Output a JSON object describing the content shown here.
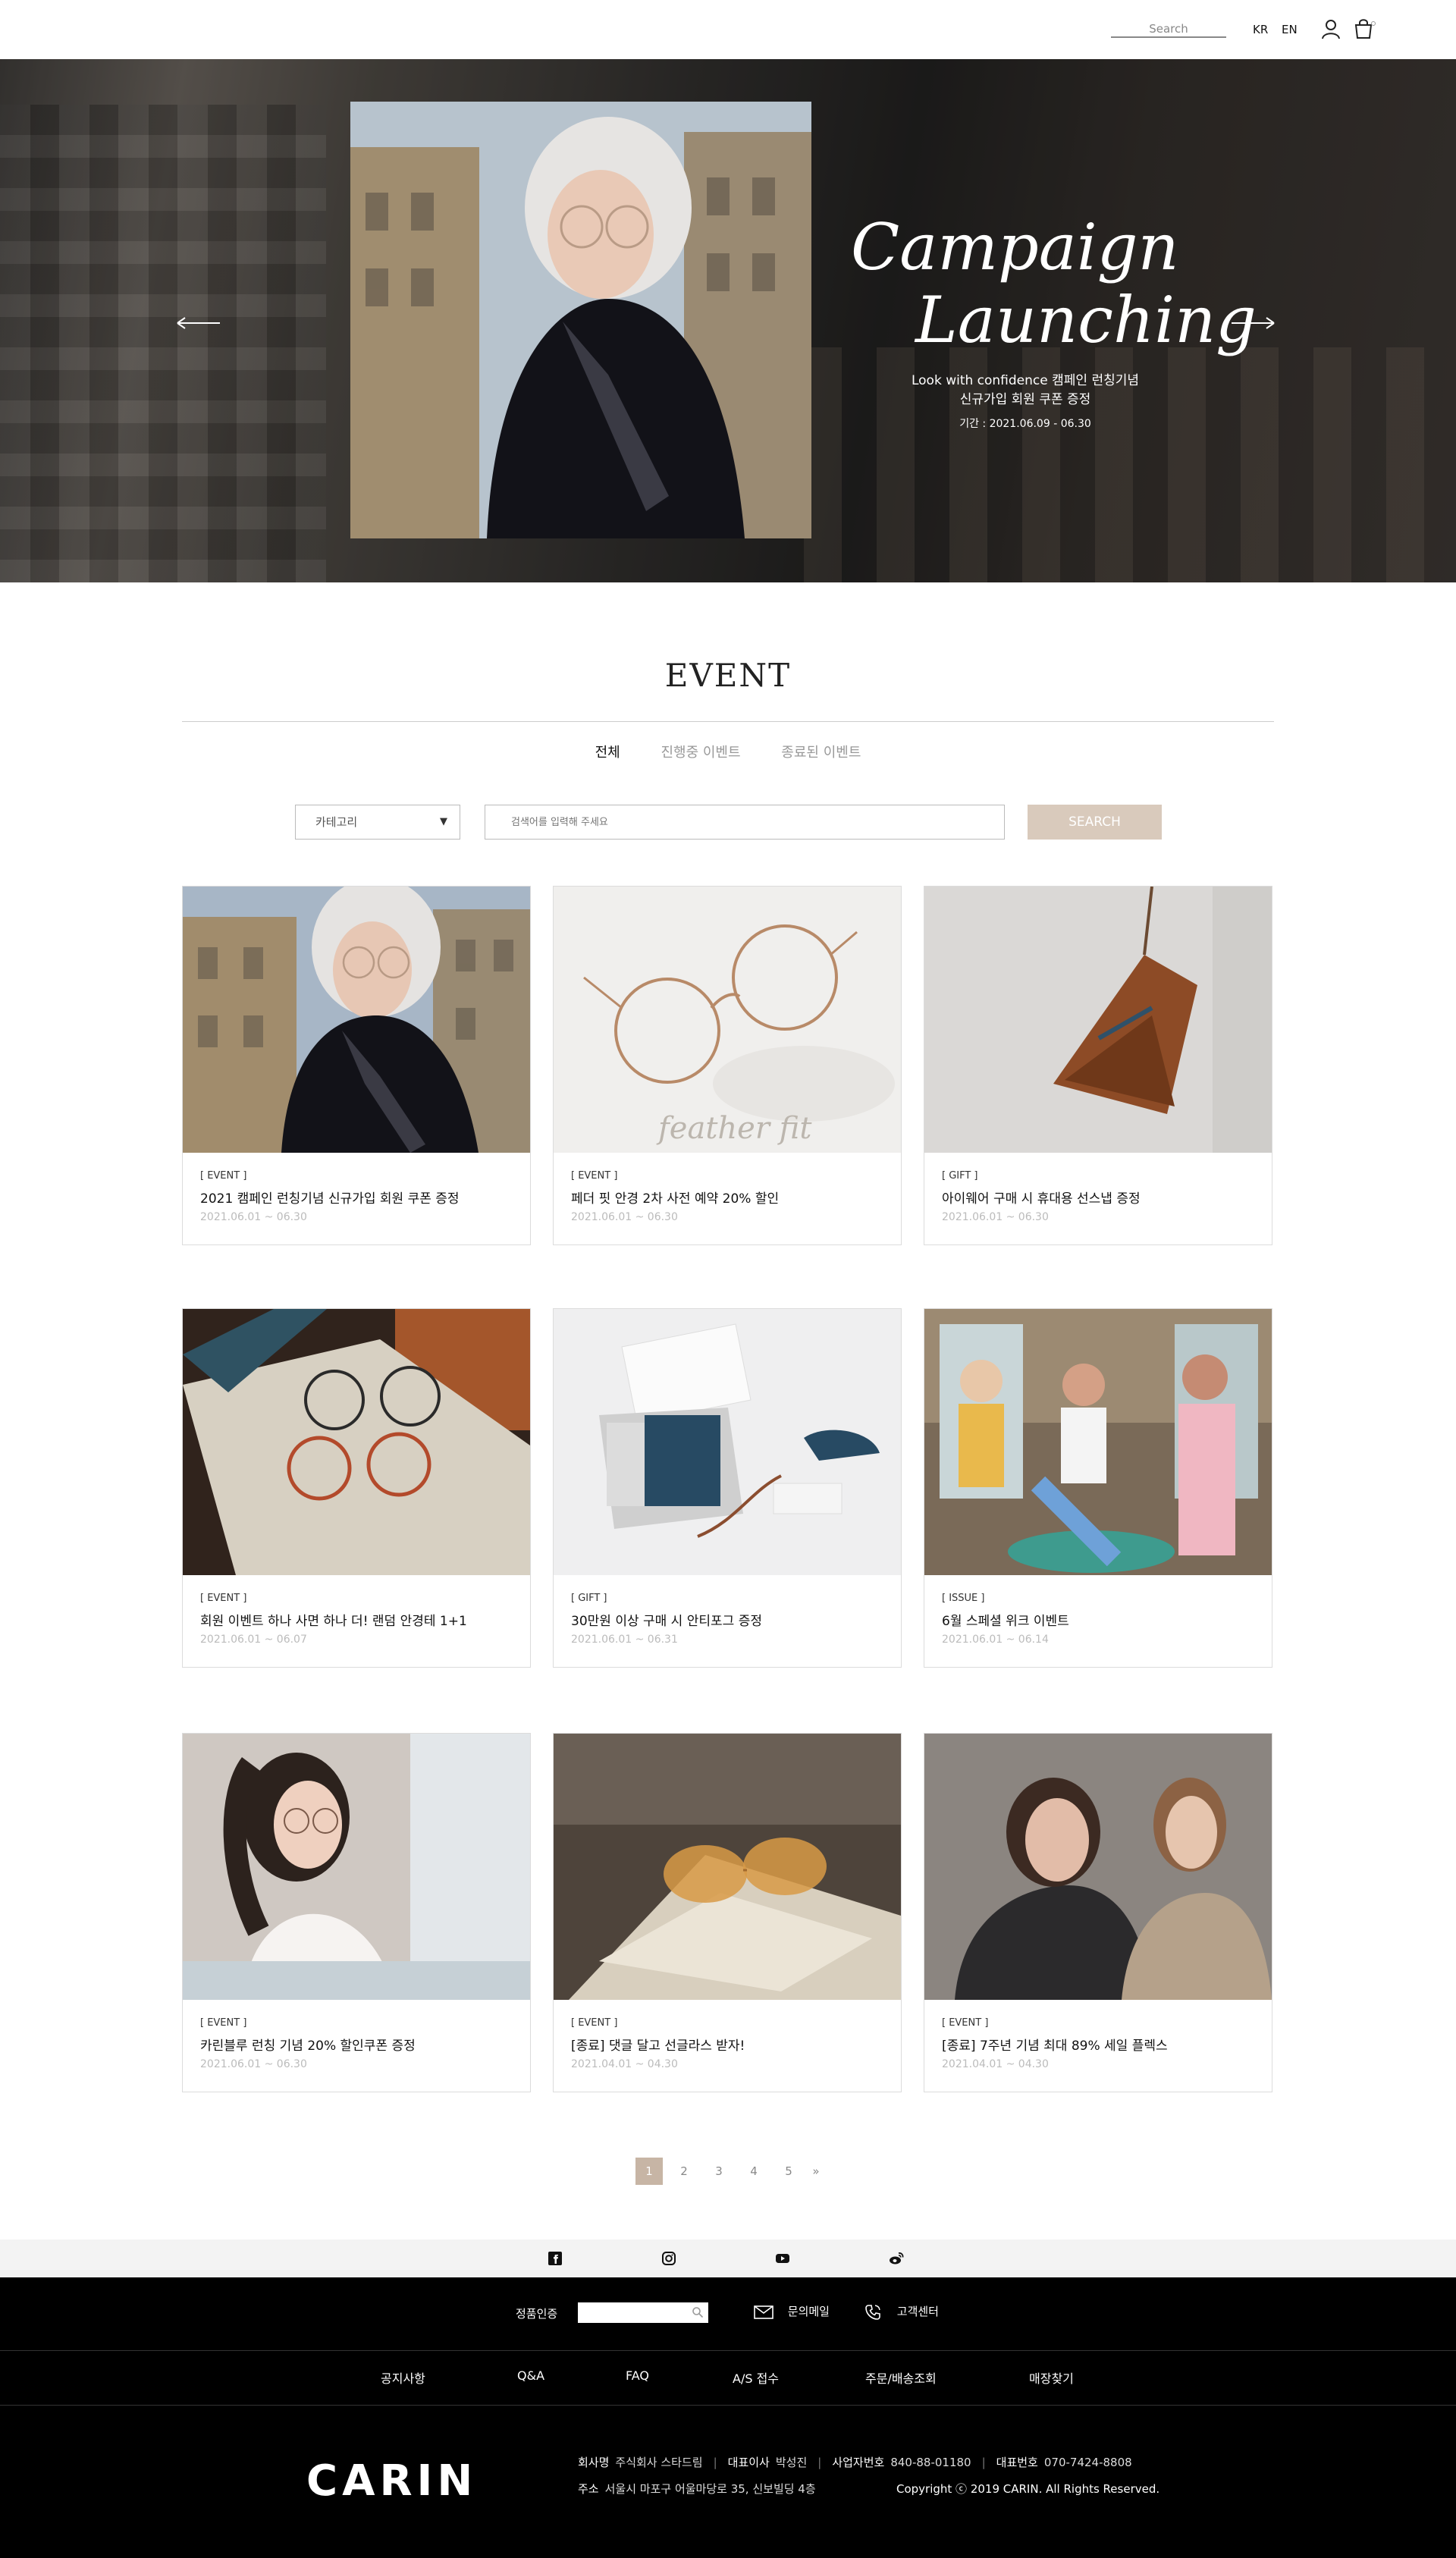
{
  "header": {
    "search_placeholder": "Search",
    "lang_kr": "KR",
    "lang_en": "EN",
    "user_icon": "user-icon",
    "cart_icon": "cart-icon"
  },
  "hero": {
    "title_line1": "Campaign",
    "title_line2": "Launching",
    "subtitle_line1": "Look with confidence 캠페인 런칭기념",
    "subtitle_line2": "신규가입 회원 쿠폰 증정",
    "period": "기간 : 2021.06.09 - 06.30",
    "prev_icon": "arrow-left-icon",
    "next_icon": "arrow-right-icon"
  },
  "event": {
    "title": "EVENT",
    "tabs": [
      "전체",
      "진행중 이벤트",
      "종료된 이벤트"
    ],
    "active_tab": 0,
    "category_label": "카테고리",
    "search_placeholder": "검색어를 입력해 주세요",
    "search_button": "SEARCH"
  },
  "cards": [
    {
      "cat": "[ EVENT ]",
      "title": "2021 캠페인 런칭기념 신규가입 회원 쿠폰 증정",
      "date": "2021.06.01 ~ 06.30"
    },
    {
      "cat": "[ EVENT ]",
      "title": "페더 핏 안경 2차 사전 예약 20% 할인",
      "date": "2021.06.01 ~ 06.30",
      "img_text": "feather fit"
    },
    {
      "cat": "[ GIFT ]",
      "title": "아이웨어 구매 시 휴대용 선스냅 증정",
      "date": "2021.06.01 ~ 06.30"
    },
    {
      "cat": "[ EVENT ]",
      "title": "회원 이벤트 하나 사면 하나 더! 랜덤 안경테 1+1",
      "date": "2021.06.01 ~ 06.07"
    },
    {
      "cat": "[ GIFT ]",
      "title": "30만원 이상 구매 시 안티포그 증정",
      "date": "2021.06.01 ~ 06.31"
    },
    {
      "cat": "[ ISSUE ]",
      "title": "6월 스페셜 위크 이벤트",
      "date": "2021.06.01 ~ 06.14"
    },
    {
      "cat": "[ EVENT ]",
      "title": "카린블루 런칭 기념 20% 할인쿠폰 증정",
      "date": "2021.06.01 ~ 06.30"
    },
    {
      "cat": "[ EVENT ]",
      "title": "[종료] 댓글 달고 선글라스 받자!",
      "date": "2021.04.01 ~ 04.30"
    },
    {
      "cat": "[ EVENT ]",
      "title": "[종료] 7주년 기념 최대 89% 세일 플렉스",
      "date": "2021.04.01 ~ 04.30"
    }
  ],
  "pagination": {
    "pages": [
      "1",
      "2",
      "3",
      "4",
      "5"
    ],
    "active": 0,
    "next": "»"
  },
  "social": [
    "facebook-icon",
    "instagram-icon",
    "youtube-icon",
    "weibo-icon"
  ],
  "footer": {
    "auth_label": "정품인증",
    "mail_label": "문의메일",
    "cs_label": "고객센터",
    "nav": [
      "공지사항",
      "Q&A",
      "FAQ",
      "A/S 접수",
      "주문/배송조회",
      "매장찾기"
    ],
    "logo": "CARIN",
    "company_key": "회사명",
    "company_val": "주식회사 스타드림",
    "ceo_key": "대표이사",
    "ceo_val": "박성진",
    "biz_key": "사업자번호",
    "biz_val": "840-88-01180",
    "phone_key": "대표번호",
    "phone_val": "070-7424-8808",
    "addr_key": "주소",
    "addr_val": "서울시 마포구 어울마당로 35, 신보빌딩 4층",
    "copyright": "Copyright ⓒ 2019 CARIN. All Rights Reserved."
  }
}
